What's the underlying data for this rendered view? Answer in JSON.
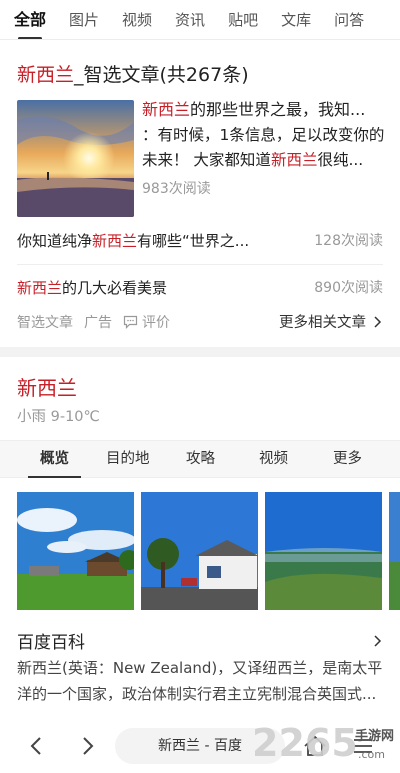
{
  "top_tabs": [
    "全部",
    "图片",
    "视频",
    "资讯",
    "贴吧",
    "文库",
    "问答"
  ],
  "section1": {
    "title_highlight": "新西兰",
    "title_rest": "_智选文章(共267条)",
    "article1": {
      "title_highlight": "新西兰",
      "title_rest": "的那些世界之最，我知...",
      "snippet_a": "：有时候，1条信息，足以改变你的未来！ 大家都知道",
      "snippet_highlight": "新西兰",
      "snippet_b": "很纯...",
      "reads": "983次阅读"
    },
    "article2": {
      "pre": "你知道纯净",
      "highlight": "新西兰",
      "post": "有哪些“世界之...",
      "reads": "128次阅读"
    },
    "article3": {
      "highlight": "新西兰",
      "post": "的几大必看美景",
      "reads": "890次阅读"
    },
    "meta": {
      "source": "智选文章",
      "ad": "广告",
      "comment": "评价",
      "more": "更多相关文章"
    }
  },
  "section2": {
    "title": "新西兰",
    "weather": "小雨 9-10℃",
    "tabs": [
      "概览",
      "目的地",
      "攻略",
      "视频",
      "更多"
    ],
    "baike_title": "百度百科",
    "baike_desc": "新西兰(英语：New Zealand)，又译纽西兰，是南太平洋的一个国家，政治体制实行君主立宪制混合英国式..."
  },
  "bottom_bar": {
    "address": "新西兰 - 百度"
  },
  "watermark": {
    "text": "2265",
    "sub": "手游网",
    "url": ".com"
  },
  "colors": {
    "highlight": "#c61f27",
    "muted": "#999999"
  }
}
